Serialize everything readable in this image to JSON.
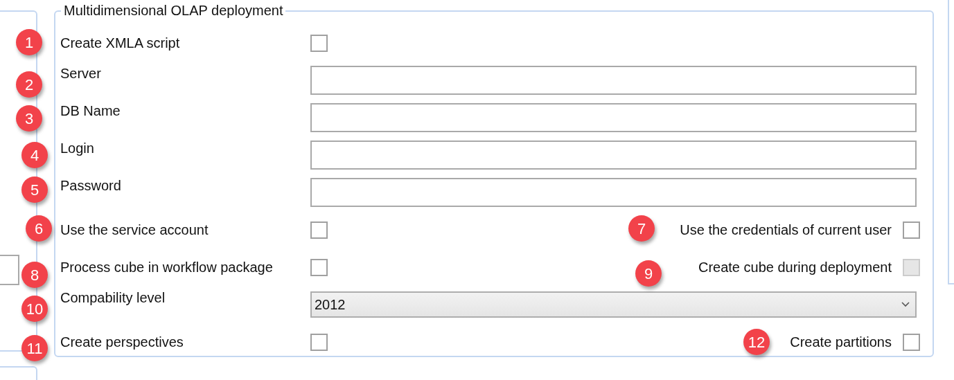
{
  "group": {
    "title": "Multidimensional OLAP deployment"
  },
  "rows": [
    {
      "kind": "checkbox",
      "label": "Create XMLA script",
      "checked": false
    },
    {
      "kind": "text",
      "label": "Server"
    },
    {
      "kind": "text",
      "label": "DB Name"
    },
    {
      "kind": "text",
      "label": "Login"
    },
    {
      "kind": "text",
      "label": "Password"
    },
    {
      "kind": "checkbox",
      "label": "Use the service account",
      "checked": false,
      "right": {
        "label": "Use the credentials of current user",
        "checked": false,
        "disabled": false
      }
    },
    {
      "kind": "checkbox",
      "label": "Process cube in workflow package",
      "checked": false,
      "right": {
        "label": "Create cube during deployment",
        "checked": false,
        "disabled": true
      }
    },
    {
      "kind": "select",
      "label": "Compability level",
      "value": "2012"
    },
    {
      "kind": "checkbox",
      "label": "Create perspectives",
      "checked": false,
      "right": {
        "label": "Create partitions",
        "checked": false,
        "disabled": false
      }
    }
  ],
  "badges": [
    {
      "label": "1"
    },
    {
      "label": "2"
    },
    {
      "label": "3"
    },
    {
      "label": "4"
    },
    {
      "label": "5"
    },
    {
      "label": "6"
    },
    {
      "label": "7"
    },
    {
      "label": "8"
    },
    {
      "label": "9"
    },
    {
      "label": "10"
    },
    {
      "label": "11"
    },
    {
      "label": "12"
    }
  ]
}
